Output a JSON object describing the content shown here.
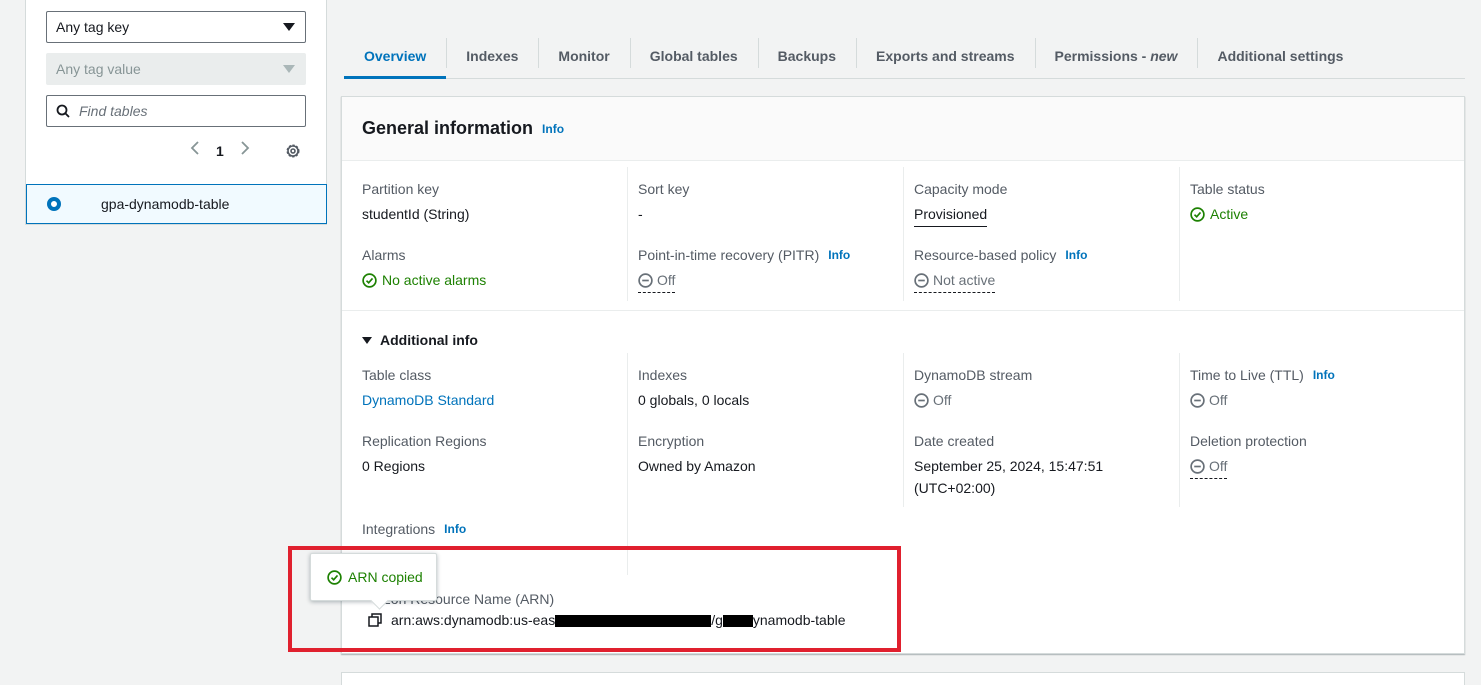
{
  "filters": {
    "tag_key": "Any tag key",
    "tag_value": "Any tag value",
    "search_placeholder": "Find tables",
    "page": "1"
  },
  "tables": [
    {
      "name": "gpa-dynamodb-table",
      "selected": true
    }
  ],
  "tabs": [
    {
      "label": "Overview",
      "active": true
    },
    {
      "label": "Indexes"
    },
    {
      "label": "Monitor"
    },
    {
      "label": "Global tables"
    },
    {
      "label": "Backups"
    },
    {
      "label": "Exports and streams"
    },
    {
      "label": "Permissions - ",
      "suffix": "new"
    },
    {
      "label": "Additional settings"
    }
  ],
  "general": {
    "title": "General information",
    "info": "Info",
    "partition_key_label": "Partition key",
    "partition_key_value": "studentId (String)",
    "sort_key_label": "Sort key",
    "sort_key_value": "-",
    "capacity_label": "Capacity mode",
    "capacity_value": "Provisioned",
    "status_label": "Table status",
    "status_value": "Active",
    "alarms_label": "Alarms",
    "alarms_value": "No active alarms",
    "pitr_label": "Point-in-time recovery (PITR)",
    "pitr_info": "Info",
    "pitr_value": "Off",
    "policy_label": "Resource-based policy",
    "policy_info": "Info",
    "policy_value": "Not active"
  },
  "additional": {
    "title": "Additional info",
    "table_class_label": "Table class",
    "table_class_value": "DynamoDB Standard",
    "indexes_label": "Indexes",
    "indexes_value": "0 globals, 0 locals",
    "stream_label": "DynamoDB stream",
    "stream_value": "Off",
    "ttl_label": "Time to Live (TTL)",
    "ttl_info": "Info",
    "ttl_value": "Off",
    "replication_label": "Replication Regions",
    "replication_value": "0 Regions",
    "encryption_label": "Encryption",
    "encryption_value": "Owned by Amazon",
    "date_label": "Date created",
    "date_value_1": "September 25, 2024, 15:47:51",
    "date_value_2": "(UTC+02:00)",
    "deletion_label": "Deletion protection",
    "deletion_value": "Off",
    "integrations_label": "Integrations",
    "integrations_info": "Info",
    "arn_label_visible": "azon Resource Name (ARN)",
    "arn_prefix": "arn:aws:dynamodb:us-eas",
    "arn_mid": "/g",
    "arn_suffix": "ynamodb-table"
  },
  "popover": {
    "text": "ARN copied"
  },
  "colors": {
    "accent": "#0073bb",
    "success": "#1d8102",
    "highlight": "#e0202e"
  }
}
